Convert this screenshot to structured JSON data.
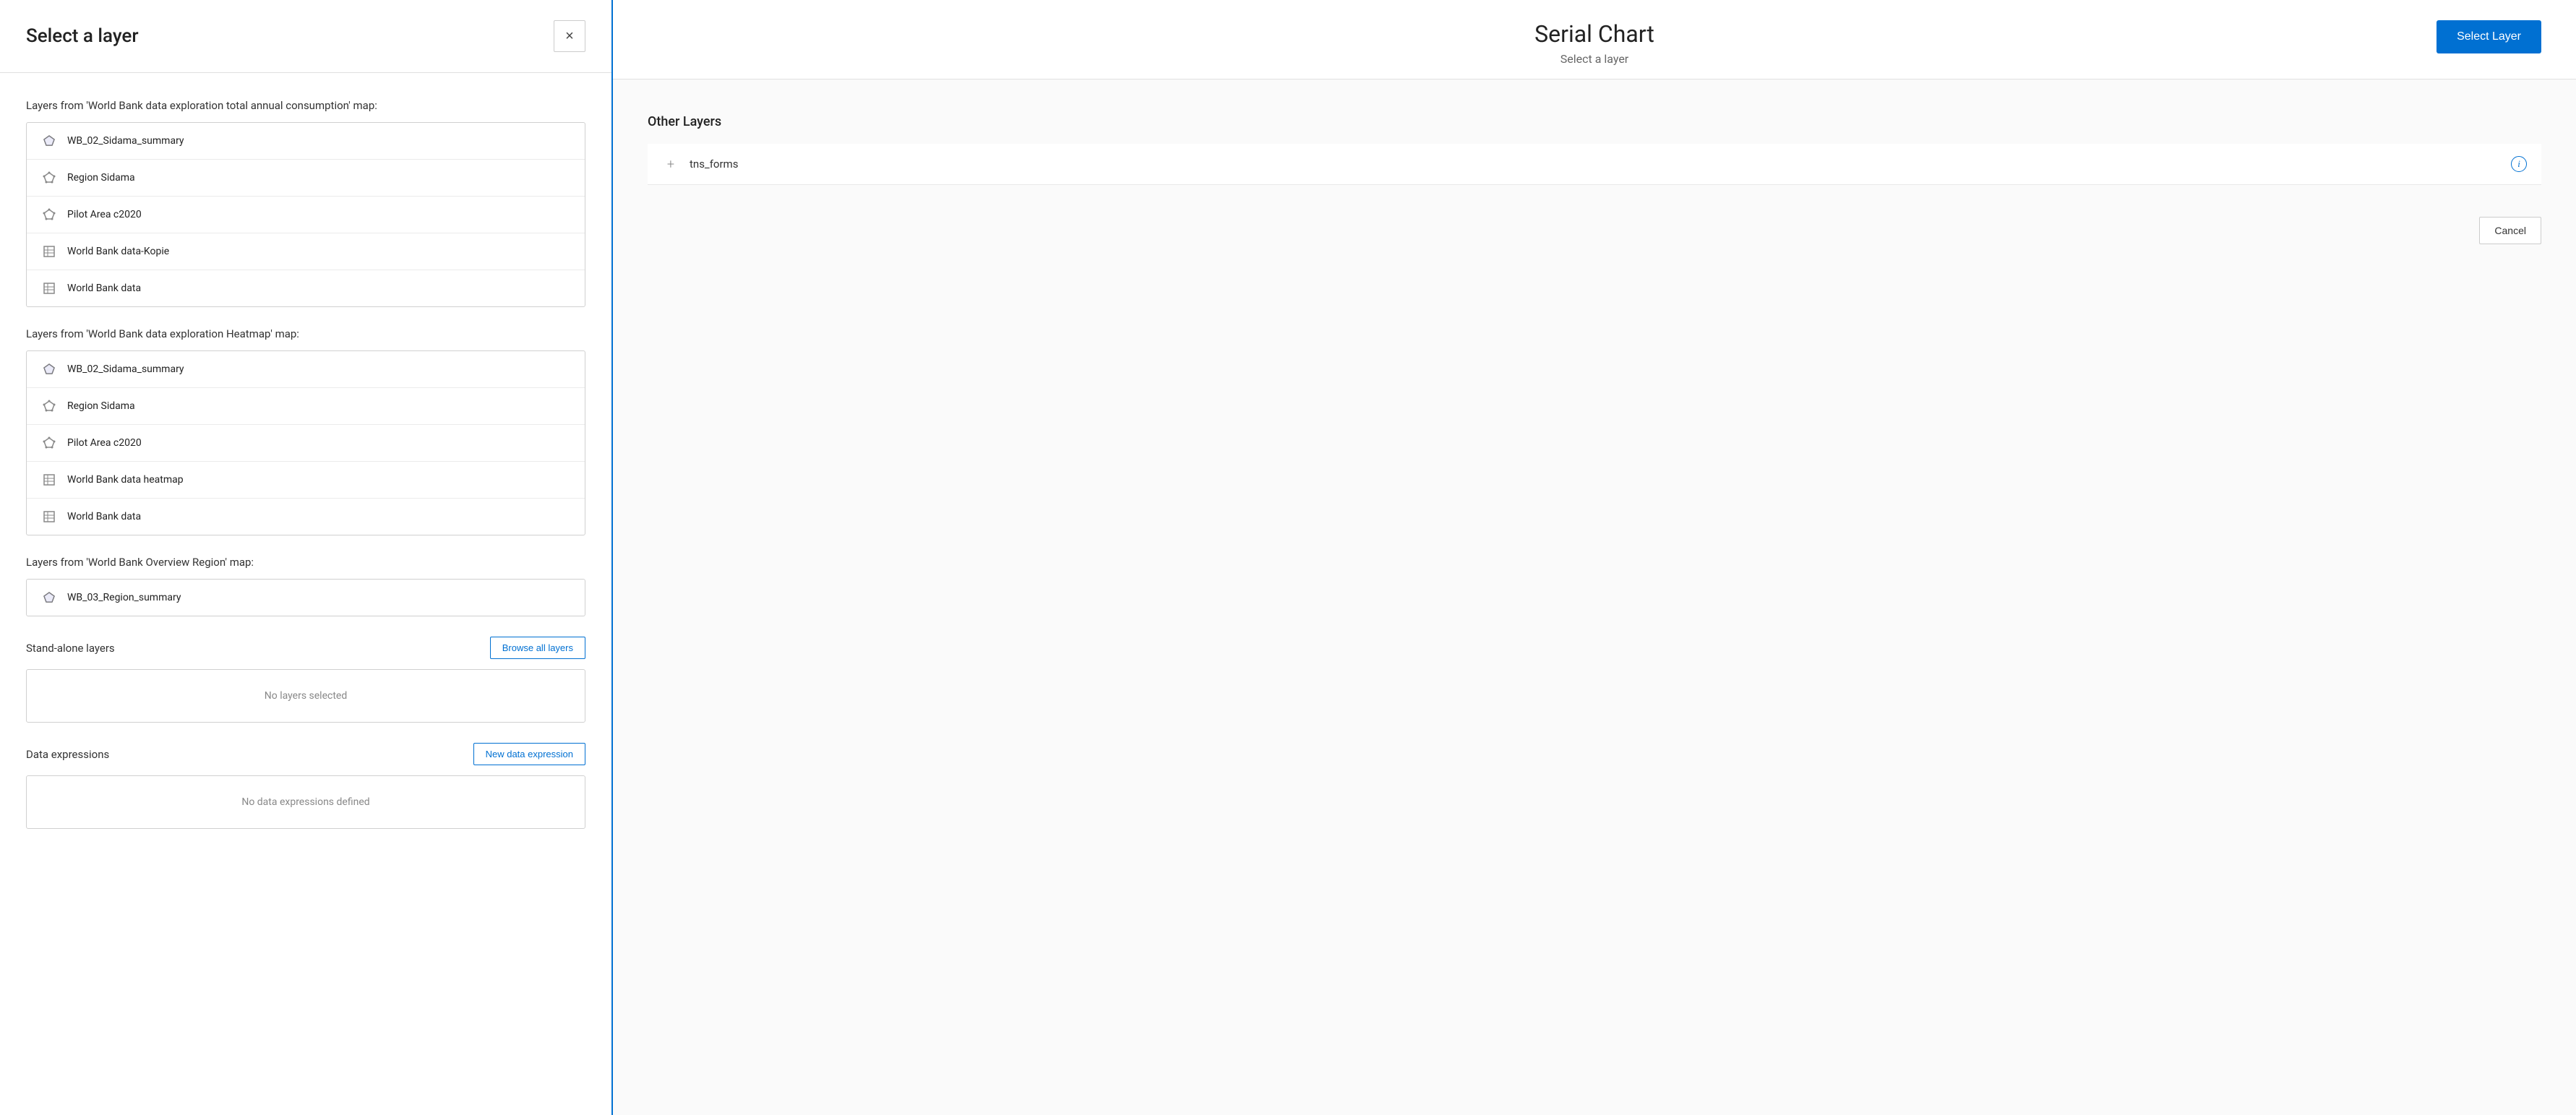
{
  "dialog": {
    "title": "Select a layer",
    "close_label": "×",
    "map_groups": [
      {
        "label": "Layers from 'World Bank data exploration total annual consumption' map:",
        "layers": [
          {
            "name": "WB_02_Sidama_summary",
            "icon": "polygon"
          },
          {
            "name": "Region Sidama",
            "icon": "polygon-outline"
          },
          {
            "name": "Pilot Area c2020",
            "icon": "polygon-outline"
          },
          {
            "name": "World Bank data-Kopie",
            "icon": "table"
          },
          {
            "name": "World Bank data",
            "icon": "table"
          }
        ]
      },
      {
        "label": "Layers from 'World Bank data exploration Heatmap' map:",
        "layers": [
          {
            "name": "WB_02_Sidama_summary",
            "icon": "polygon"
          },
          {
            "name": "Region Sidama",
            "icon": "polygon-outline"
          },
          {
            "name": "Pilot Area c2020",
            "icon": "polygon-outline"
          },
          {
            "name": "World Bank data heatmap",
            "icon": "table"
          },
          {
            "name": "World Bank data",
            "icon": "table"
          }
        ]
      },
      {
        "label": "Layers from 'World Bank Overview Region' map:",
        "layers": [
          {
            "name": "WB_03_Region_summary",
            "icon": "polygon"
          }
        ]
      }
    ],
    "standalone_section": {
      "title": "Stand-alone layers",
      "browse_button": "Browse all layers",
      "empty_text": "No layers selected"
    },
    "data_expressions_section": {
      "title": "Data expressions",
      "new_button": "New data expression",
      "empty_text": "No data expressions defined"
    }
  },
  "right_panel": {
    "title": "Serial Chart",
    "subtitle": "Select a layer",
    "select_layer_button": "Select Layer",
    "other_layers_title": "Other Layers",
    "other_layers": [
      {
        "name": "tns_forms"
      }
    ],
    "cancel_button": "Cancel"
  }
}
